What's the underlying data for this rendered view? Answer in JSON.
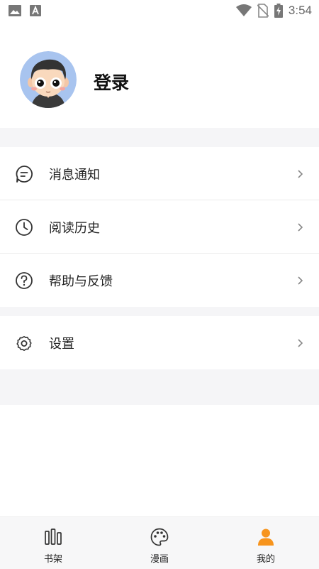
{
  "status_bar": {
    "time": "3:54",
    "icons": [
      "image-icon",
      "text-a-icon",
      "wifi-icon",
      "no-sim-icon",
      "battery-charging-icon"
    ]
  },
  "profile": {
    "login_label": "登录",
    "avatar_icon": "cartoon-avatar"
  },
  "menu": {
    "items": [
      {
        "label": "消息通知",
        "icon": "message-icon"
      },
      {
        "label": "阅读历史",
        "icon": "clock-icon"
      },
      {
        "label": "帮助与反馈",
        "icon": "help-icon"
      },
      {
        "label": "设置",
        "icon": "gear-icon"
      }
    ]
  },
  "bottom_nav": {
    "items": [
      {
        "label": "书架",
        "icon": "bookshelf-icon",
        "active": false
      },
      {
        "label": "漫画",
        "icon": "palette-icon",
        "active": false
      },
      {
        "label": "我的",
        "icon": "person-icon",
        "active": true
      }
    ]
  },
  "colors": {
    "accent": "#f7941d",
    "section_gap": "#f5f5f7",
    "text": "#222222"
  }
}
